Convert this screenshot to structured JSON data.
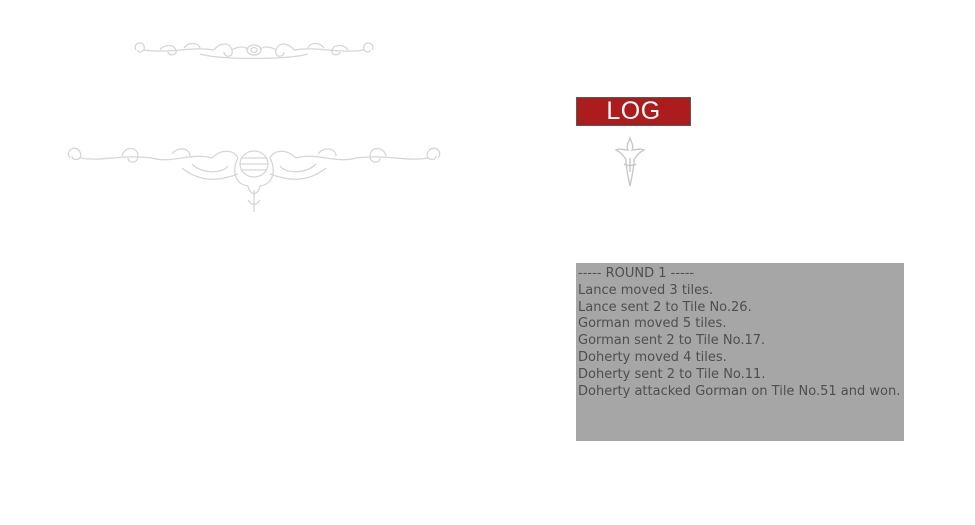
{
  "colors": {
    "log_button_bg": "#ac1c1c",
    "log_panel_bg": "#a6a6a6",
    "log_text": "#4f4f4f",
    "ornament_stroke": "#d6d6d6"
  },
  "icons": {
    "top_ornament": "scroll-ornament-icon",
    "middle_ornament": "scroll-ornament-icon",
    "fleur": "fleur-de-lis-icon"
  },
  "log_button": {
    "label": "LOG"
  },
  "log": {
    "lines": [
      "----- ROUND 1 -----",
      "Lance moved 3 tiles.",
      "Lance sent 2 to Tile No.26.",
      "Gorman moved 5 tiles.",
      "Gorman sent 2 to Tile No.17.",
      "Doherty moved 4 tiles.",
      "Doherty sent 2 to Tile No.11.",
      "Doherty attacked Gorman on Tile No.51 and won."
    ]
  }
}
